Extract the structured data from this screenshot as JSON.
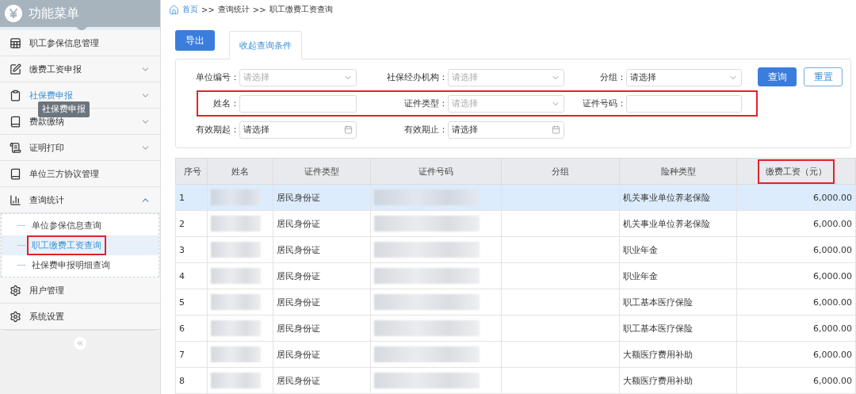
{
  "sidebar": {
    "title": "功能菜单",
    "tooltip": "社保费申报",
    "items": [
      {
        "label": "职工参保信息管理",
        "selected": false
      },
      {
        "label": "缴费工资申报",
        "selected": false,
        "expanded": false
      },
      {
        "label": "社保费申报",
        "selected": true,
        "expanded": false,
        "tooltip_shown": true
      },
      {
        "label": "费款缴纳",
        "selected": false,
        "expanded": false
      },
      {
        "label": "证明打印",
        "selected": false,
        "expanded": false
      },
      {
        "label": "单位三方协议管理",
        "selected": false
      },
      {
        "label": "查询统计",
        "selected": false,
        "expanded": true,
        "children": [
          {
            "label": "单位参保信息查询",
            "selected": false,
            "highlighted": false
          },
          {
            "label": "职工缴费工资查询",
            "selected": true,
            "highlighted": true
          },
          {
            "label": "社保费申报明细查询",
            "selected": false,
            "highlighted": false
          }
        ]
      },
      {
        "label": "用户管理",
        "selected": false
      },
      {
        "label": "系统设置",
        "selected": false
      }
    ]
  },
  "breadcrumb": [
    "首页",
    ">>",
    "查询统计",
    ">>",
    "职工缴费工资查询"
  ],
  "toolbar": {
    "export_button": "导出",
    "tab": "收起查询条件"
  },
  "filters": {
    "rows": [
      {
        "highlighted": false,
        "fields": [
          {
            "kind": "select",
            "label": "单位编号：",
            "placeholder": "请选择"
          },
          {
            "kind": "select",
            "label": "社保经办机构：",
            "placeholder": "请选择"
          },
          {
            "kind": "select",
            "label": "分组：",
            "value": "请选择"
          }
        ]
      },
      {
        "highlighted": true,
        "fields": [
          {
            "kind": "text",
            "label": "姓名："
          },
          {
            "kind": "select",
            "label": "证件类型：",
            "placeholder": "请选择"
          },
          {
            "kind": "text",
            "label": "证件号码："
          }
        ]
      },
      {
        "highlighted": false,
        "fields": [
          {
            "kind": "date",
            "label": "有效期起：",
            "value": "请选择"
          },
          {
            "kind": "date",
            "label": "有效期止：",
            "value": "请选择"
          }
        ]
      }
    ],
    "buttons": [
      {
        "kind": "primary",
        "label": "查询"
      },
      {
        "kind": "outline",
        "label": "重置"
      }
    ]
  },
  "table": {
    "columns": [
      {
        "label": "序号",
        "highlighted": false
      },
      {
        "label": "姓名",
        "highlighted": false
      },
      {
        "label": "证件类型",
        "highlighted": false
      },
      {
        "label": "证件号码",
        "highlighted": false
      },
      {
        "label": "分组",
        "highlighted": false
      },
      {
        "label": "险种类型",
        "highlighted": false
      },
      {
        "label": "缴费工资（元）",
        "highlighted": true
      }
    ],
    "rows": [
      {
        "selected": true,
        "cells": [
          {
            "kind": "text",
            "text": "1"
          },
          {
            "kind": "redacted"
          },
          {
            "kind": "text",
            "text": "居民身份证"
          },
          {
            "kind": "redacted"
          },
          {
            "kind": "text",
            "text": ""
          },
          {
            "kind": "text",
            "text": "机关事业单位养老保险"
          },
          {
            "kind": "number",
            "text": "6,000.00"
          }
        ]
      },
      {
        "selected": false,
        "cells": [
          {
            "kind": "text",
            "text": "2"
          },
          {
            "kind": "redacted"
          },
          {
            "kind": "text",
            "text": "居民身份证"
          },
          {
            "kind": "redacted"
          },
          {
            "kind": "text",
            "text": ""
          },
          {
            "kind": "text",
            "text": "机关事业单位养老保险"
          },
          {
            "kind": "number",
            "text": "6,000.00"
          }
        ]
      },
      {
        "selected": false,
        "cells": [
          {
            "kind": "text",
            "text": "3"
          },
          {
            "kind": "redacted"
          },
          {
            "kind": "text",
            "text": "居民身份证"
          },
          {
            "kind": "redacted"
          },
          {
            "kind": "text",
            "text": ""
          },
          {
            "kind": "text",
            "text": "职业年金"
          },
          {
            "kind": "number",
            "text": "6,000.00"
          }
        ]
      },
      {
        "selected": false,
        "cells": [
          {
            "kind": "text",
            "text": "4"
          },
          {
            "kind": "redacted"
          },
          {
            "kind": "text",
            "text": "居民身份证"
          },
          {
            "kind": "redacted"
          },
          {
            "kind": "text",
            "text": ""
          },
          {
            "kind": "text",
            "text": "职业年金"
          },
          {
            "kind": "number",
            "text": "6,000.00"
          }
        ]
      },
      {
        "selected": false,
        "cells": [
          {
            "kind": "text",
            "text": "5"
          },
          {
            "kind": "redacted"
          },
          {
            "kind": "text",
            "text": "居民身份证"
          },
          {
            "kind": "redacted"
          },
          {
            "kind": "text",
            "text": ""
          },
          {
            "kind": "text",
            "text": "职工基本医疗保险"
          },
          {
            "kind": "number",
            "text": "6,000.00"
          }
        ]
      },
      {
        "selected": false,
        "cells": [
          {
            "kind": "text",
            "text": "6"
          },
          {
            "kind": "redacted"
          },
          {
            "kind": "text",
            "text": "居民身份证"
          },
          {
            "kind": "redacted"
          },
          {
            "kind": "text",
            "text": ""
          },
          {
            "kind": "text",
            "text": "职工基本医疗保险"
          },
          {
            "kind": "number",
            "text": "6,000.00"
          }
        ]
      },
      {
        "selected": false,
        "cells": [
          {
            "kind": "text",
            "text": "7"
          },
          {
            "kind": "redacted"
          },
          {
            "kind": "text",
            "text": "居民身份证"
          },
          {
            "kind": "redacted"
          },
          {
            "kind": "text",
            "text": ""
          },
          {
            "kind": "text",
            "text": "大额医疗费用补助"
          },
          {
            "kind": "number",
            "text": "6,000.00"
          }
        ]
      },
      {
        "selected": false,
        "cells": [
          {
            "kind": "text",
            "text": "8"
          },
          {
            "kind": "redacted"
          },
          {
            "kind": "text",
            "text": "居民身份证"
          },
          {
            "kind": "redacted"
          },
          {
            "kind": "text",
            "text": ""
          },
          {
            "kind": "text",
            "text": "大额医疗费用补助"
          },
          {
            "kind": "number",
            "text": "6,000.00"
          }
        ]
      }
    ]
  }
}
